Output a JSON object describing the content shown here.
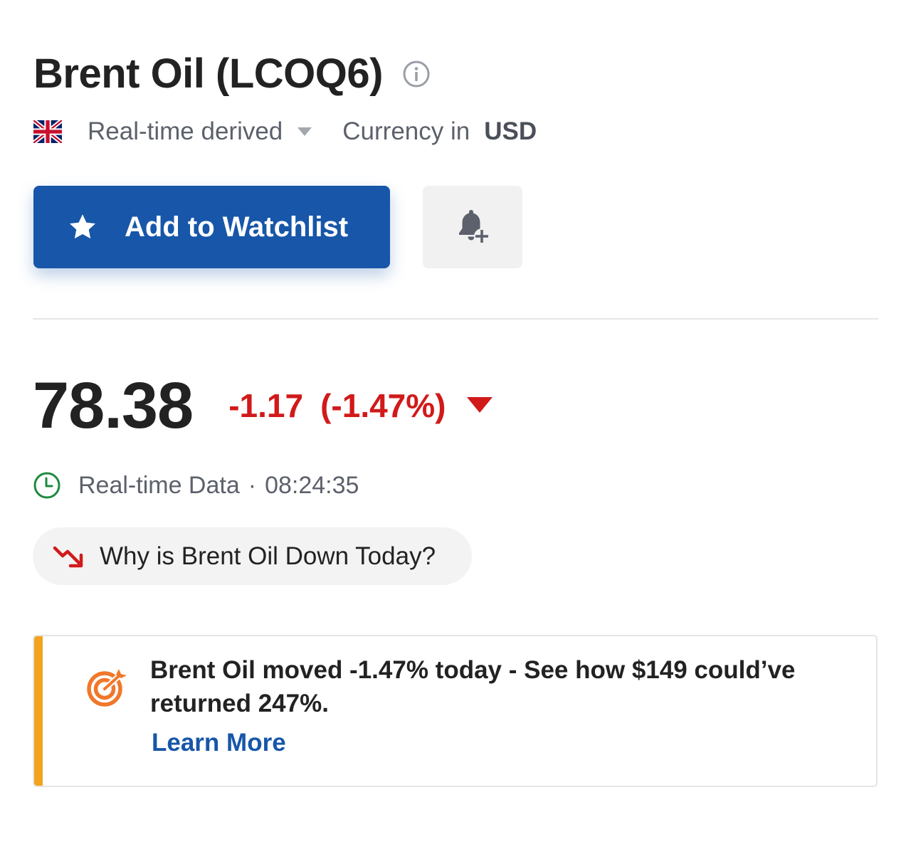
{
  "header": {
    "title": "Brent Oil (LCOQ6)",
    "info_icon": "info-circle-icon"
  },
  "meta": {
    "flag_icon": "uk-flag-icon",
    "source_label": "Real-time derived",
    "currency_prefix": "Currency in",
    "currency": "USD"
  },
  "actions": {
    "watchlist_label": "Add to Watchlist",
    "watchlist_icon": "star-icon",
    "alert_icon": "bell-plus-icon"
  },
  "quote": {
    "price": "78.38",
    "change": "-1.17",
    "change_percent": "(-1.47%)",
    "direction": "down"
  },
  "realtime": {
    "label": "Real-time Data",
    "separator": "·",
    "time": "08:24:35"
  },
  "why_pill": {
    "label": "Why is Brent Oil Down Today?",
    "icon": "trend-down-icon"
  },
  "promo": {
    "text": "Brent Oil moved -1.47% today - See how $149 could’ve returned 247%.",
    "link": "Learn More",
    "icon": "target-icon"
  },
  "colors": {
    "primary": "#1756a9",
    "negative": "#d11a1a",
    "accent_bar": "#f4a31d",
    "clock_green": "#1e8a3e",
    "target_orange": "#f0782a"
  }
}
